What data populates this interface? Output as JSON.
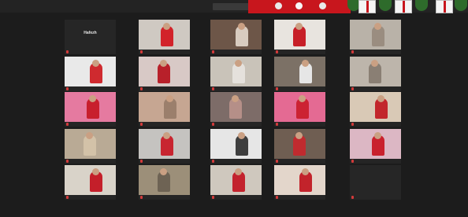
{
  "window": {
    "meeting_label": "",
    "colors": {
      "background": "#1c1c1c",
      "tile_background": "#252525",
      "mic_muted": "#d23a3a",
      "banner_red": "#c8161d"
    }
  },
  "tiles": [
    {
      "center_name": "Hafezh",
      "name": ""
    },
    {
      "center_name": "",
      "name": ""
    },
    {
      "center_name": "",
      "name": ""
    },
    {
      "center_name": "",
      "name": ""
    },
    {
      "center_name": "",
      "name": ""
    },
    {
      "center_name": "",
      "name": ""
    },
    {
      "center_name": "",
      "name": ""
    },
    {
      "center_name": "",
      "name": ""
    },
    {
      "center_name": "",
      "name": ""
    },
    {
      "center_name": "",
      "name": ""
    },
    {
      "center_name": "",
      "name": ""
    },
    {
      "center_name": "",
      "name": ""
    },
    {
      "center_name": "",
      "name": ""
    },
    {
      "center_name": "",
      "name": ""
    },
    {
      "center_name": "",
      "name": ""
    },
    {
      "center_name": "",
      "name": ""
    },
    {
      "center_name": "",
      "name": ""
    },
    {
      "center_name": "",
      "name": ""
    },
    {
      "center_name": "",
      "name": ""
    },
    {
      "center_name": "",
      "name": ""
    },
    {
      "center_name": "",
      "name": ""
    },
    {
      "center_name": "",
      "name": ""
    },
    {
      "center_name": "",
      "name": ""
    },
    {
      "center_name": "",
      "name": ""
    },
    {
      "center_name": "",
      "name": ""
    }
  ]
}
